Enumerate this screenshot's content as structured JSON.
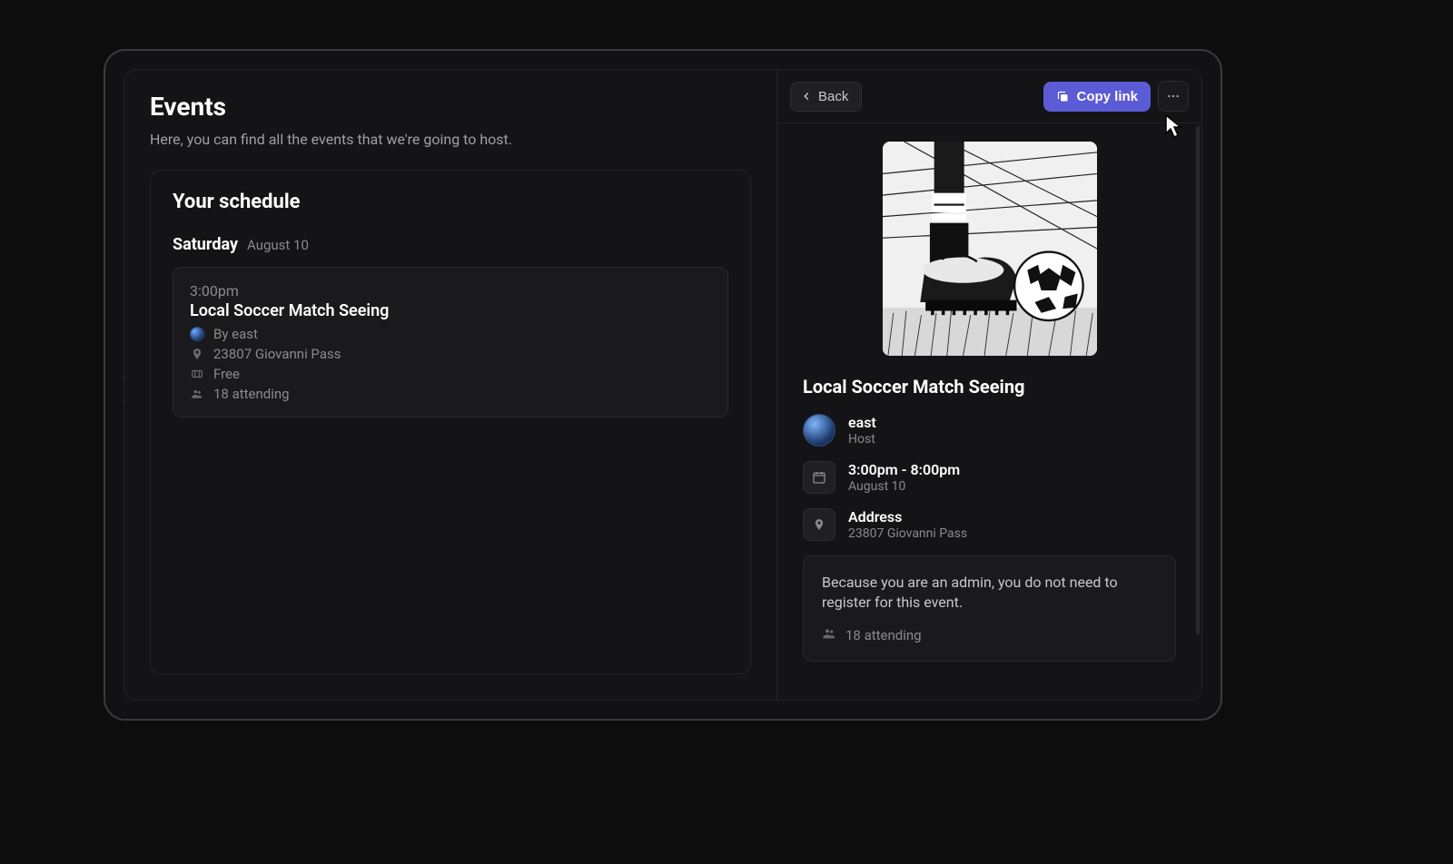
{
  "page": {
    "title": "Events",
    "subtitle": "Here, you can find all the events that we're going to host."
  },
  "schedule": {
    "heading": "Your schedule",
    "day_name": "Saturday",
    "day_date": "August 10",
    "event": {
      "time": "3:00pm",
      "name": "Local Soccer Match Seeing",
      "host_line": "By east",
      "location": "23807 Giovanni Pass",
      "price": "Free",
      "attending": "18 attending"
    }
  },
  "detail": {
    "back_label": "Back",
    "copy_label": "Copy link",
    "title": "Local Soccer Match Seeing",
    "host": {
      "name": "east",
      "role": "Host"
    },
    "when": {
      "time_range": "3:00pm - 8:00pm",
      "date": "August 10"
    },
    "where": {
      "label": "Address",
      "value": "23807 Giovanni Pass"
    },
    "admin_notice": "Because you are an admin, you do not need to register for this event.",
    "attending": "18 attending"
  },
  "colors": {
    "accent": "#5b5bd6"
  }
}
